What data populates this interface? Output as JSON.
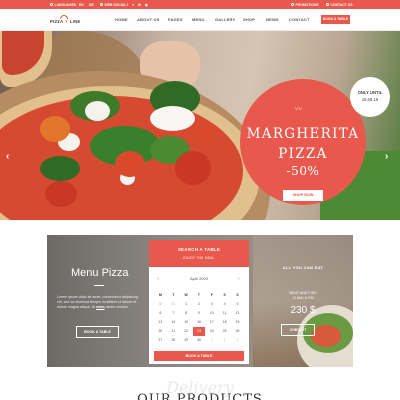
{
  "topbar": {
    "languages": "LANGUAGES",
    "lang_en": "EN",
    "lang_de": "DE",
    "web_social": "WEB SOCIAL",
    "promotions": "PROMOTIONS",
    "contact_us": "CONTACT US"
  },
  "header": {
    "logo_left": "PIZZA",
    "logo_right": "LINE",
    "nav": [
      "HOME",
      "ABOUT US",
      "PAGES",
      "MENU",
      "GALLERY",
      "SHOP",
      "NEWS",
      "CONTACT"
    ],
    "book_button": "BOOK A TABLE"
  },
  "hero": {
    "title": "MARGHERITA PIZZA",
    "discount": "-50%",
    "shop_button": "SHOP NOW",
    "badge_line1": "ONLY UNTIL",
    "badge_line2": "15.09.18",
    "slides": 3,
    "active_slide": 1
  },
  "menu": {
    "title": "Menu Pizza",
    "text_before_link": "Lorem ipsum dolor sit amet, consectetur adipiscing elit, sed do eiusmod tempor incididunt ut labore et dolore magna aliqua. Ut",
    "link": "enim",
    "text_after_link": "minim veniam.",
    "button": "BOOK A TABLE"
  },
  "calendar": {
    "title": "SEARCH A TABLE",
    "subtitle": "ENJOY THE MEAL",
    "prev": "‹",
    "next": "›",
    "month": "April 2020",
    "day_headers": [
      "M",
      "T",
      "W",
      "T",
      "F",
      "S",
      "S"
    ],
    "weeks": [
      [
        "30",
        "31",
        "1",
        "2",
        "3",
        "4",
        "5"
      ],
      [
        "6",
        "7",
        "8",
        "9",
        "10",
        "11",
        "12"
      ],
      [
        "13",
        "14",
        "15",
        "16",
        "17",
        "18",
        "19"
      ],
      [
        "20",
        "21",
        "22",
        "23",
        "24",
        "25",
        "26"
      ],
      [
        "27",
        "28",
        "29",
        "30",
        "1",
        "2",
        "3"
      ]
    ],
    "selected": "23",
    "book_button": "BOOK A TABLE"
  },
  "offer": {
    "title": "ALL YOU CAN EAT",
    "line1": "MEAT AND FISH",
    "line2": "11 AM / 6 PM",
    "price": "230 $",
    "button": "CHECK IT"
  },
  "products": {
    "script_title": "Delivery",
    "title": "OUR PRODUCTS"
  },
  "colors": {
    "accent": "#e8584c"
  }
}
